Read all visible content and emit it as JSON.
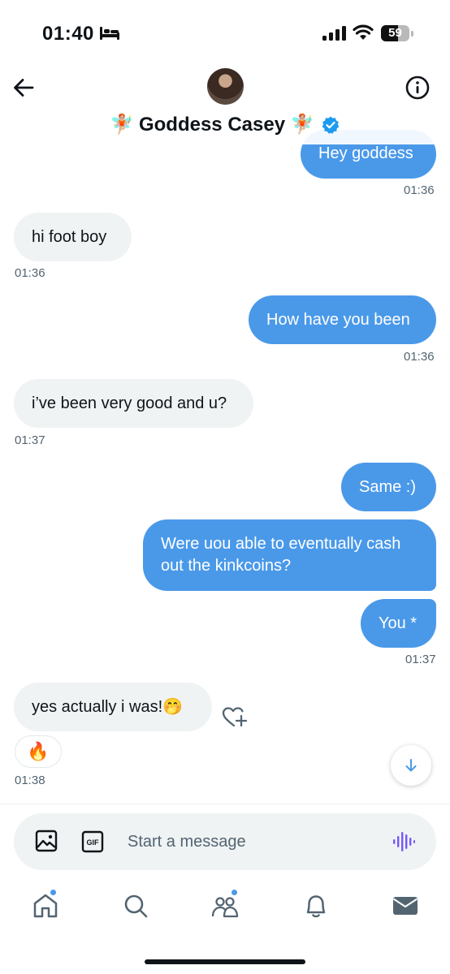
{
  "status_bar": {
    "time": "01:40",
    "battery": "59",
    "battery_level": 0.59
  },
  "header": {
    "name": "Goddess Casey",
    "name_emoji": "🧚🏼"
  },
  "messages": [
    {
      "text": "Hey goddess",
      "time": "01:36"
    },
    {
      "text": "hi foot boy",
      "time": "01:36"
    },
    {
      "text": "How have you been",
      "time": "01:36"
    },
    {
      "text": "i’ve been very good and u?",
      "time": "01:37"
    },
    {
      "text": "Same :)"
    },
    {
      "text": "Were uou able to eventually cash out the kinkcoins?"
    },
    {
      "text": "You *",
      "time": "01:37"
    },
    {
      "text": "yes actually i was!🤭",
      "time": "01:38",
      "reaction": "🔥"
    }
  ],
  "composer": {
    "placeholder": "Start a message",
    "gif_label": "GIF"
  },
  "colors": {
    "accent": "#4a99e9",
    "incoming_bubble": "#eff3f4",
    "outgoing_bubble": "#4a99e9",
    "voice": "#7856ff"
  },
  "icons": [
    "back-arrow-icon",
    "info-icon",
    "verified-badge-icon",
    "heart-plus-icon",
    "arrow-down-icon",
    "image-icon",
    "gif-icon",
    "voice-icon",
    "home-icon",
    "search-icon",
    "communities-icon",
    "bell-icon",
    "mail-icon"
  ]
}
